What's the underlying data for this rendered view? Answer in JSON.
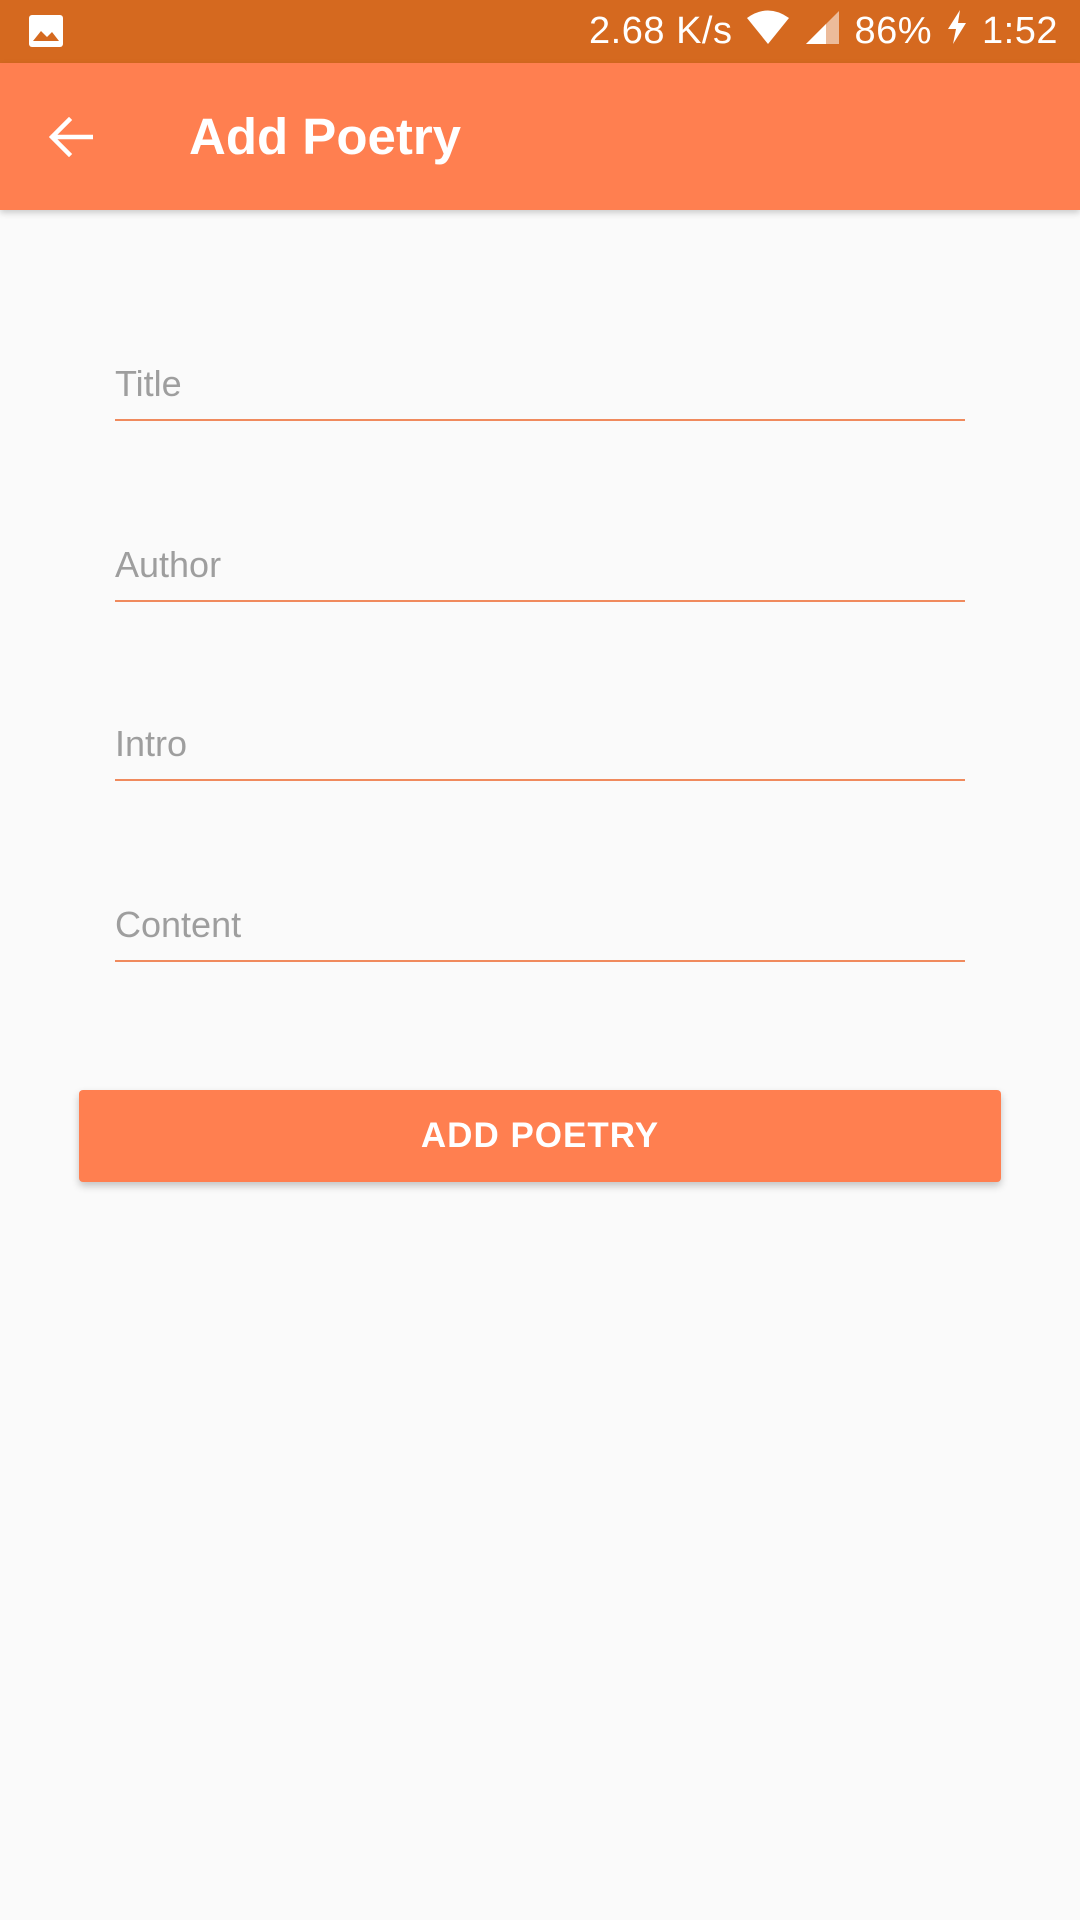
{
  "status_bar": {
    "notification_icon": "image-icon",
    "network_speed": "2.68 K/s",
    "wifi_icon": "wifi-icon",
    "signal_icon": "cell-signal-icon",
    "battery": "86%",
    "charging_icon": "bolt-icon",
    "time": "1:52"
  },
  "app_bar": {
    "back_icon": "arrow-left-icon",
    "title": "Add Poetry"
  },
  "form": {
    "title": {
      "placeholder": "Title",
      "value": ""
    },
    "author": {
      "placeholder": "Author",
      "value": ""
    },
    "intro": {
      "placeholder": "Intro",
      "value": ""
    },
    "content": {
      "placeholder": "Content",
      "value": ""
    }
  },
  "submit_button": {
    "label": "ADD POETRY"
  },
  "colors": {
    "status_bar": "#D5691F",
    "primary": "#FF7F50",
    "underline": "#F08A5D",
    "background": "#FAFAFA",
    "hint_text": "#9E9E9E"
  }
}
